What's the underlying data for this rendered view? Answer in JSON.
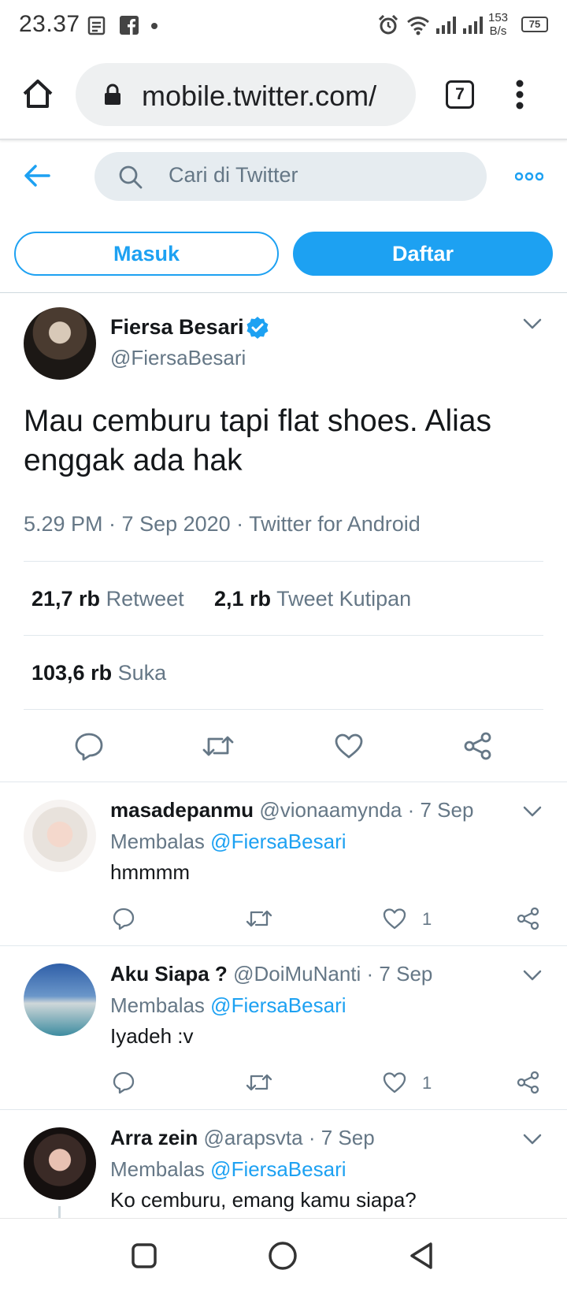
{
  "status_bar": {
    "time": "23.37",
    "net_speed_value": "153",
    "net_speed_unit": "B/s",
    "battery": "75"
  },
  "browser": {
    "url": "mobile.twitter.com/",
    "tab_count": "7"
  },
  "header": {
    "search_placeholder": "Cari di Twitter",
    "login_label": "Masuk",
    "signup_label": "Daftar"
  },
  "tweet": {
    "author_name": "Fiersa Besari",
    "author_handle": "@FiersaBesari",
    "text": "Mau cemburu tapi flat shoes. Alias enggak ada hak",
    "meta": "5.29 PM · 7 Sep 2020 · Twitter for Android",
    "retweets_count": "21,7 rb",
    "retweets_label": "Retweet",
    "quotes_count": "2,1 rb",
    "quotes_label": "Tweet Kutipan",
    "likes_count": "103,6 rb",
    "likes_label": "Suka"
  },
  "replies": [
    {
      "name": "masadepanmu",
      "handle": "@vionaamynda",
      "date": "· 7 Sep",
      "replying_prefix": "Membalas",
      "replying_to": "@FiersaBesari",
      "text": "hmmmm",
      "likes": "1"
    },
    {
      "name": "Aku Siapa ?",
      "handle": "@DoiMuNanti",
      "date": "· 7 Sep",
      "replying_prefix": "Membalas",
      "replying_to": "@FiersaBesari",
      "text": "Iyadeh :v",
      "likes": "1"
    },
    {
      "name": "Arra zein",
      "handle": "@arapsvta",
      "date": "· 7 Sep",
      "replying_prefix": "Membalas",
      "replying_to": "@FiersaBesari",
      "text": "Ko cemburu, emang kamu siapa?",
      "likes": ""
    }
  ],
  "colors": {
    "twitter_blue": "#1da1f2",
    "secondary_text": "#657786"
  }
}
